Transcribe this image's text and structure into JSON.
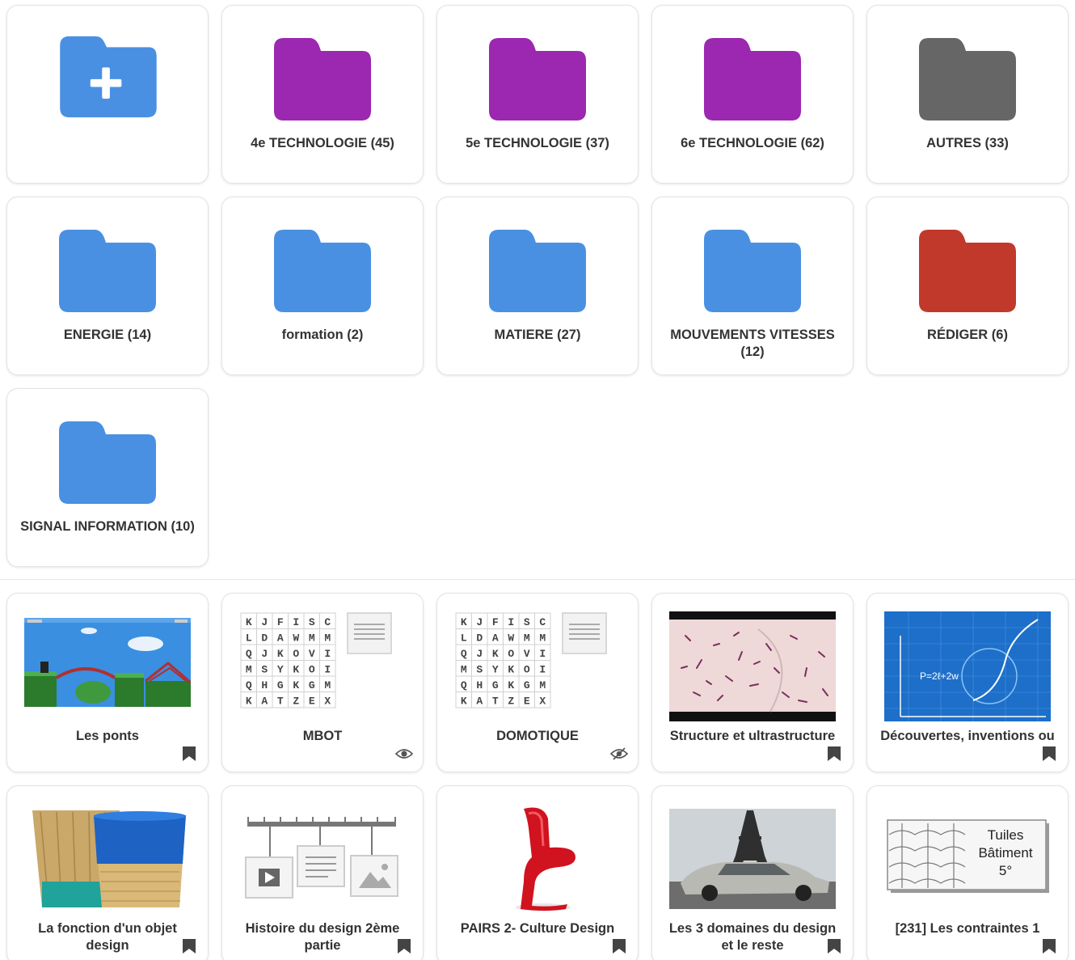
{
  "folders": [
    {
      "label": "",
      "icon": "new-folder-icon",
      "color": "#4a90e2"
    },
    {
      "label": "4e TECHNOLOGIE (45)",
      "icon": "folder-icon",
      "color": "#9c27b0"
    },
    {
      "label": "5e TECHNOLOGIE (37)",
      "icon": "folder-icon",
      "color": "#9c27b0"
    },
    {
      "label": "6e TECHNOLOGIE (62)",
      "icon": "folder-icon",
      "color": "#9c27b0"
    },
    {
      "label": "AUTRES (33)",
      "icon": "folder-icon",
      "color": "#666666"
    },
    {
      "label": "ENERGIE (14)",
      "icon": "folder-icon",
      "color": "#4a90e2"
    },
    {
      "label": "formation (2)",
      "icon": "folder-icon",
      "color": "#4a90e2"
    },
    {
      "label": "MATIERE (27)",
      "icon": "folder-icon",
      "color": "#4a90e2"
    },
    {
      "label": "MOUVEMENTS VITESSES (12)",
      "icon": "folder-icon",
      "color": "#4a90e2"
    },
    {
      "label": "RÉDIGER (6)",
      "icon": "folder-icon",
      "color": "#c0392b"
    },
    {
      "label": "SIGNAL INFORMATION (10)",
      "icon": "folder-icon",
      "color": "#4a90e2"
    }
  ],
  "items": [
    {
      "label": "Les ponts",
      "thumbnail": "bridge-game-thumbnail",
      "status": "bookmark-icon"
    },
    {
      "label": "MBOT",
      "thumbnail": "word-search-thumbnail",
      "status": "eye-icon"
    },
    {
      "label": "DOMOTIQUE",
      "thumbnail": "word-search-thumbnail",
      "status": "eye-off-icon"
    },
    {
      "label": "Structure et ultrastructure",
      "thumbnail": "microscope-thumbnail",
      "status": "bookmark-icon"
    },
    {
      "label": "Découvertes, inventions ou",
      "thumbnail": "math-blueprint-thumbnail",
      "status": "bookmark-icon"
    },
    {
      "label": "La fonction d'un objet design",
      "thumbnail": "baskets-thumbnail",
      "status": "bookmark-icon"
    },
    {
      "label": "Histoire du design 2ème partie",
      "thumbnail": "timeline-thumbnail",
      "status": "bookmark-icon"
    },
    {
      "label": "PAIRS 2- Culture Design",
      "thumbnail": "red-chair-thumbnail",
      "status": "bookmark-icon"
    },
    {
      "label": "Les 3 domaines du design et le reste",
      "thumbnail": "eiffel-car-thumbnail",
      "status": "bookmark-icon"
    },
    {
      "label": "[231] Les contraintes 1",
      "thumbnail": "tuiles-thumbnail",
      "status": "bookmark-icon"
    }
  ],
  "word_grid": {
    "rows": [
      [
        "K",
        "J",
        "F",
        "I",
        "S",
        "C"
      ],
      [
        "L",
        "D",
        "A",
        "W",
        "M",
        "M"
      ],
      [
        "Q",
        "J",
        "K",
        "O",
        "V",
        "I"
      ],
      [
        "M",
        "S",
        "Y",
        "K",
        "O",
        "I"
      ],
      [
        "Q",
        "H",
        "G",
        "K",
        "G",
        "M"
      ],
      [
        "K",
        "A",
        "T",
        "Z",
        "E",
        "X"
      ]
    ]
  },
  "thumb_text": {
    "formula": "P=2ℓ+2w",
    "tuiles": [
      "Tuiles",
      "Bâtiment",
      "5°"
    ]
  },
  "colors": {
    "bookmark": "#444444",
    "eye": "#555555"
  }
}
